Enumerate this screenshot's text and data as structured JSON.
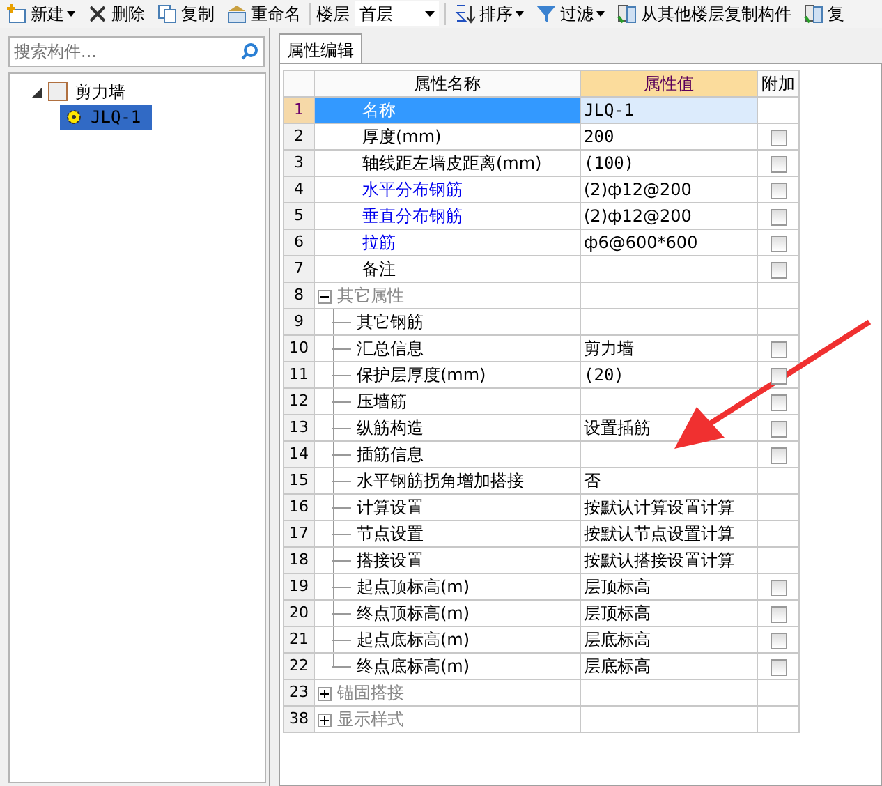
{
  "toolbar": [
    {
      "kind": "button",
      "label": "新建",
      "caret": true
    },
    {
      "kind": "button",
      "label": "删除",
      "caret": false
    },
    {
      "kind": "button",
      "label": "复制",
      "caret": false
    },
    {
      "kind": "button",
      "label": "重命名",
      "caret": false
    },
    {
      "kind": "select",
      "label": "楼层",
      "value": "首层"
    },
    {
      "kind": "button",
      "label": "排序",
      "caret": true
    },
    {
      "kind": "button",
      "label": "过滤",
      "caret": true
    },
    {
      "kind": "button",
      "label": "从其他楼层复制构件",
      "caret": false
    },
    {
      "kind": "button",
      "label": "复",
      "caret": false
    }
  ],
  "search": {
    "placeholder": "搜索构件..."
  },
  "tree": [
    {
      "label": "剪力墙",
      "expanded": true,
      "children": [
        {
          "label": "JLQ-1",
          "selected": true
        }
      ]
    }
  ],
  "tab": {
    "label": "属性编辑"
  },
  "table": {
    "columns": [
      "属性名称",
      "属性值",
      "附加"
    ],
    "rows": [
      {
        "kind": "prop",
        "num": "1",
        "name": "名称",
        "value": "JLQ-1",
        "linked": false,
        "selected": true
      },
      {
        "kind": "prop",
        "num": "2",
        "name": "厚度(mm)",
        "value": "200",
        "linked": false,
        "selected": false,
        "checked": false
      },
      {
        "kind": "prop",
        "num": "3",
        "name": "轴线距左墙皮距离(mm)",
        "value": "(100)",
        "linked": false,
        "selected": false,
        "checked": false
      },
      {
        "kind": "prop",
        "num": "4",
        "name": "水平分布钢筋",
        "value": "(2)ф12@200",
        "linked": true,
        "selected": false,
        "checked": false
      },
      {
        "kind": "prop",
        "num": "5",
        "name": "垂直分布钢筋",
        "value": "(2)ф12@200",
        "linked": true,
        "selected": false,
        "checked": false
      },
      {
        "kind": "prop",
        "num": "6",
        "name": "拉筋",
        "value": "ф6@600*600",
        "linked": true,
        "selected": false,
        "checked": false
      },
      {
        "kind": "prop",
        "num": "7",
        "name": "备注",
        "value": "",
        "linked": false,
        "selected": false,
        "checked": false
      },
      {
        "kind": "group",
        "num": "8",
        "name": "其它属性",
        "expanded": true,
        "selected": false,
        "children": [
          {
            "kind": "child",
            "num": "9",
            "name": "其它钢筋",
            "selected": false
          },
          {
            "kind": "child",
            "num": "10",
            "name": "汇总信息",
            "value": "剪力墙",
            "selected": false,
            "checked": false
          },
          {
            "kind": "child",
            "num": "11",
            "name": "保护层厚度(mm)",
            "value": "(20)",
            "selected": false,
            "checked": false
          },
          {
            "kind": "child",
            "num": "12",
            "name": "压墙筋",
            "selected": false,
            "checked": false
          },
          {
            "kind": "child",
            "num": "13",
            "name": "纵筋构造",
            "value": "设置插筋",
            "selected": false,
            "checked": false
          },
          {
            "kind": "child",
            "num": "14",
            "name": "插筋信息",
            "selected": false,
            "checked": false
          },
          {
            "kind": "child",
            "num": "15",
            "name": "水平钢筋拐角增加搭接",
            "value": "否",
            "selected": false
          },
          {
            "kind": "child",
            "num": "16",
            "name": "计算设置",
            "value": "按默认计算设置计算",
            "selected": false
          },
          {
            "kind": "child",
            "num": "17",
            "name": "节点设置",
            "value": "按默认节点设置计算",
            "selected": false
          },
          {
            "kind": "child",
            "num": "18",
            "name": "搭接设置",
            "value": "按默认搭接设置计算",
            "selected": false
          },
          {
            "kind": "child",
            "num": "19",
            "name": "起点顶标高(m)",
            "value": "层顶标高",
            "selected": false,
            "checked": false
          },
          {
            "kind": "child",
            "num": "20",
            "name": "终点顶标高(m)",
            "value": "层顶标高",
            "selected": false,
            "checked": false
          },
          {
            "kind": "child",
            "num": "21",
            "name": "起点底标高(m)",
            "value": "层底标高",
            "selected": false,
            "checked": false
          },
          {
            "kind": "child",
            "num": "22",
            "name": "终点底标高(m)",
            "value": "层底标高",
            "selected": false,
            "checked": false
          }
        ]
      },
      {
        "kind": "group",
        "num": "23",
        "name": "锚固搭接",
        "expanded": false,
        "selected": false
      },
      {
        "kind": "group",
        "num": "38",
        "name": "显示样式",
        "expanded": false,
        "selected": false
      }
    ]
  }
}
